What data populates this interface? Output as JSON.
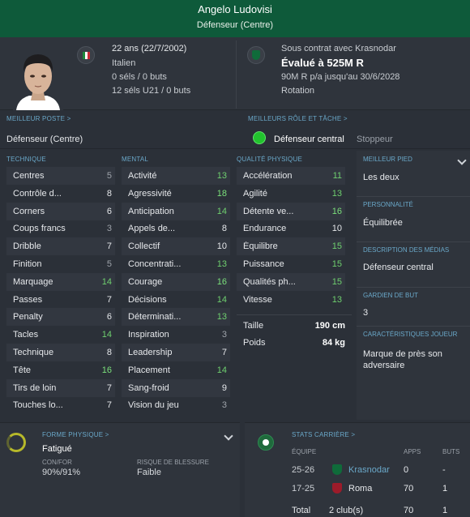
{
  "player": {
    "name": "Angelo Ludovisi",
    "position": "Défenseur (Centre)"
  },
  "bio": {
    "age_line": "22 ans (22/7/2002)",
    "nationality": "Italien",
    "caps": "0 séls / 0 buts",
    "u21_caps": "12 séls U21 / 0 buts"
  },
  "contract": {
    "status": "Sous contrat avec Krasnodar",
    "value": "Évalué à 525M R",
    "wage": "90M R p/a jusqu'au 30/6/2028",
    "squad_status": "Rotation"
  },
  "labels": {
    "best_position": "MEILLEUR POSTE >",
    "best_role": "MEILLEURS RÔLE ET TÂCHE >",
    "technique": "TECHNIQUE",
    "mental": "MENTAL",
    "physical": "QUALITÉ PHYSIQUE",
    "best_foot": "MEILLEUR PIED",
    "personality": "PERSONNALITÉ",
    "media": "DESCRIPTION DES MÉDIAS",
    "gk": "GARDIEN DE BUT",
    "traits": "CARACTÉRISTIQUES JOUEUR",
    "fitness": "FORME PHYSIQUE >",
    "career": "STATS CARRIÈRE >"
  },
  "best_position": "Défenseur (Centre)",
  "best_role": {
    "role": "Défenseur central",
    "duty": "Stoppeur"
  },
  "technical": [
    {
      "name": "Centres",
      "value": "5"
    },
    {
      "name": "Contrôle d...",
      "value": "8"
    },
    {
      "name": "Corners",
      "value": "6"
    },
    {
      "name": "Coups francs",
      "value": "3"
    },
    {
      "name": "Dribble",
      "value": "7"
    },
    {
      "name": "Finition",
      "value": "5"
    },
    {
      "name": "Marquage",
      "value": "14"
    },
    {
      "name": "Passes",
      "value": "7"
    },
    {
      "name": "Penalty",
      "value": "6"
    },
    {
      "name": "Tacles",
      "value": "14"
    },
    {
      "name": "Technique",
      "value": "8"
    },
    {
      "name": "Tête",
      "value": "16"
    },
    {
      "name": "Tirs de loin",
      "value": "7"
    },
    {
      "name": "Touches lo...",
      "value": "7"
    }
  ],
  "mental": [
    {
      "name": "Activité",
      "value": "13"
    },
    {
      "name": "Agressivité",
      "value": "18"
    },
    {
      "name": "Anticipation",
      "value": "14"
    },
    {
      "name": "Appels de...",
      "value": "8"
    },
    {
      "name": "Collectif",
      "value": "10"
    },
    {
      "name": "Concentrati...",
      "value": "13"
    },
    {
      "name": "Courage",
      "value": "16"
    },
    {
      "name": "Décisions",
      "value": "14"
    },
    {
      "name": "Déterminati...",
      "value": "13"
    },
    {
      "name": "Inspiration",
      "value": "3"
    },
    {
      "name": "Leadership",
      "value": "7"
    },
    {
      "name": "Placement",
      "value": "14"
    },
    {
      "name": "Sang-froid",
      "value": "9"
    },
    {
      "name": "Vision du jeu",
      "value": "3"
    }
  ],
  "physical": [
    {
      "name": "Accélération",
      "value": "11"
    },
    {
      "name": "Agilité",
      "value": "13"
    },
    {
      "name": "Détente ve...",
      "value": "16"
    },
    {
      "name": "Endurance",
      "value": "10"
    },
    {
      "name": "Équilibre",
      "value": "15"
    },
    {
      "name": "Puissance",
      "value": "15"
    },
    {
      "name": "Qualités ph...",
      "value": "15"
    },
    {
      "name": "Vitesse",
      "value": "13"
    }
  ],
  "physique": {
    "height_label": "Taille",
    "height": "190 cm",
    "weight_label": "Poids",
    "weight": "84 kg"
  },
  "side": {
    "best_foot": "Les deux",
    "personality": "Équilibrée",
    "media": "Défenseur central",
    "gk": "3",
    "traits_line1": "Marque de près son",
    "traits_line2": "adversaire"
  },
  "fitness": {
    "status": "Fatigué",
    "con_label": "CON/FOR",
    "con_value": "90%/91%",
    "injury_label": "RISQUE DE BLESSURE",
    "injury_value": "Faible"
  },
  "career": {
    "headers": {
      "team": "ÉQUIPE",
      "apps": "APPS",
      "goals": "BUTS"
    },
    "rows": [
      {
        "season": "25-26",
        "team": "Krasnodar",
        "apps": "0",
        "goals": "-",
        "crest": "#0f6b3a"
      },
      {
        "season": "17-25",
        "team": "Roma",
        "apps": "70",
        "goals": "1",
        "crest": "#9c1b2a"
      }
    ],
    "total": {
      "label": "Total",
      "clubs": "2 club(s)",
      "apps": "70",
      "goals": "1"
    }
  },
  "colors": {
    "header_green": "#0e5a3a",
    "accent_blue": "#6aa8c9",
    "good_green": "#6fd06f"
  }
}
